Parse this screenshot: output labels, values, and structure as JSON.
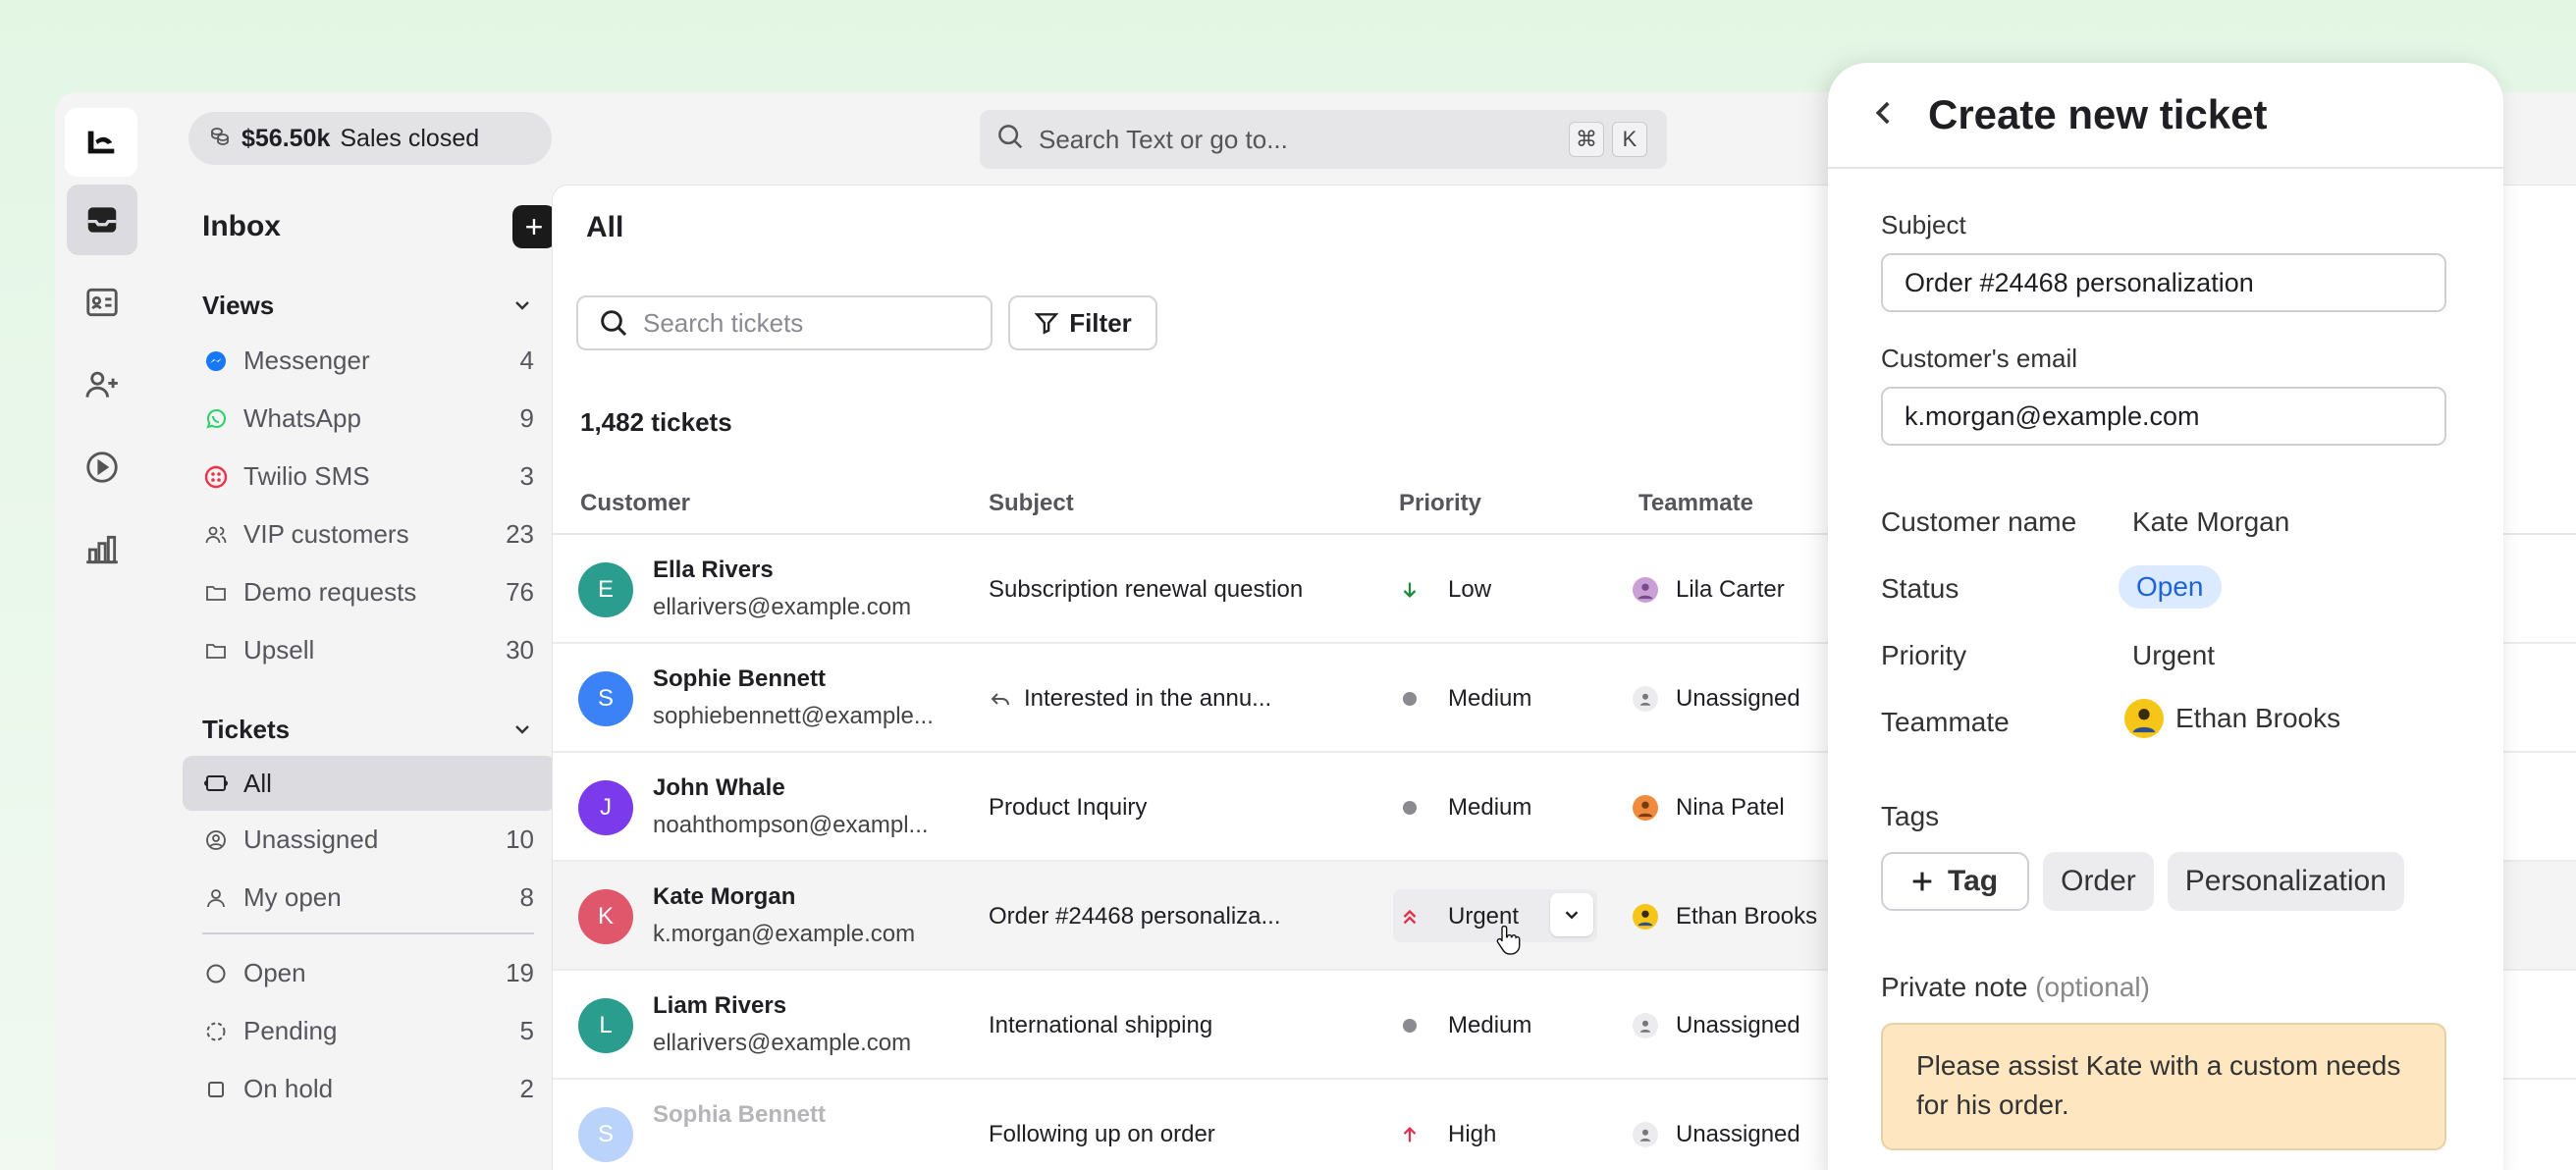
{
  "sales": {
    "amount": "$56.50k",
    "label": "Sales closed"
  },
  "search": {
    "placeholder": "Search Text or go to...",
    "kbd1": "⌘",
    "kbd2": "K"
  },
  "sidebar": {
    "inbox_title": "Inbox",
    "views_title": "Views",
    "views": [
      {
        "label": "Messenger",
        "count": "4",
        "icon": "messenger-icon"
      },
      {
        "label": "WhatsApp",
        "count": "9",
        "icon": "whatsapp-icon"
      },
      {
        "label": "Twilio SMS",
        "count": "3",
        "icon": "twilio-icon"
      },
      {
        "label": "VIP customers",
        "count": "23",
        "icon": "users-icon"
      },
      {
        "label": "Demo requests",
        "count": "76",
        "icon": "folder-icon"
      },
      {
        "label": "Upsell",
        "count": "30",
        "icon": "folder-icon"
      }
    ],
    "tickets_title": "Tickets",
    "tickets": [
      {
        "label": "All",
        "count": ""
      },
      {
        "label": "Unassigned",
        "count": "10"
      },
      {
        "label": "My open",
        "count": "8"
      }
    ],
    "statuses": [
      {
        "label": "Open",
        "count": "19"
      },
      {
        "label": "Pending",
        "count": "5"
      },
      {
        "label": "On hold",
        "count": "2"
      }
    ]
  },
  "main": {
    "title": "All",
    "search_placeholder": "Search tickets",
    "filter_label": "Filter",
    "ticket_count": "1,482 tickets",
    "columns": {
      "customer": "Customer",
      "subject": "Subject",
      "priority": "Priority",
      "teammate": "Teammate"
    },
    "rows": [
      {
        "initial": "E",
        "name": "Ella Rivers",
        "email": "ellarivers@example.com",
        "subject": "Subscription renewal question",
        "priority": "Low",
        "teammate": "Lila Carter"
      },
      {
        "initial": "S",
        "name": "Sophie Bennett",
        "email": "sophiebennett@example...",
        "subject": "Interested in the annu...",
        "priority": "Medium",
        "teammate": "Unassigned"
      },
      {
        "initial": "J",
        "name": "John Whale",
        "email": "noahthompson@exampl...",
        "subject": "Product Inquiry",
        "priority": "Medium",
        "teammate": "Nina Patel"
      },
      {
        "initial": "K",
        "name": "Kate Morgan",
        "email": "k.morgan@example.com",
        "subject": "Order #24468 personaliza...",
        "priority": "Urgent",
        "teammate": "Ethan Brooks"
      },
      {
        "initial": "L",
        "name": "Liam Rivers",
        "email": "ellarivers@example.com",
        "subject": "International shipping",
        "priority": "Medium",
        "teammate": "Unassigned"
      },
      {
        "initial": "S",
        "name": "Sophia Bennett",
        "email": "",
        "subject": "Following up on order",
        "priority": "High",
        "teammate": "Unassigned"
      }
    ]
  },
  "panel": {
    "title": "Create new ticket",
    "subject_label": "Subject",
    "subject_value": "Order #24468 personalization",
    "email_label": "Customer's email",
    "email_value": "k.morgan@example.com",
    "customer_name_label": "Customer name",
    "customer_name_value": "Kate Morgan",
    "status_label": "Status",
    "status_value": "Open",
    "priority_label": "Priority",
    "priority_value": "Urgent",
    "teammate_label": "Teammate",
    "teammate_value": "Ethan Brooks",
    "tags_label": "Tags",
    "tag_add_label": "Tag",
    "tags": [
      "Order",
      "Personalization"
    ],
    "note_label": "Private note",
    "note_optional": "(optional)",
    "note_value": "Please assist Kate with a custom needs for his order."
  },
  "colors": {
    "avatar_e": "#2a9d8f",
    "avatar_s": "#3b82f6",
    "avatar_j": "#7c3aed",
    "avatar_k": "#e0566b",
    "avatar_l": "#2a9d8f",
    "status_bg": "#dbeafe",
    "note_bg": "#fde6c0"
  }
}
